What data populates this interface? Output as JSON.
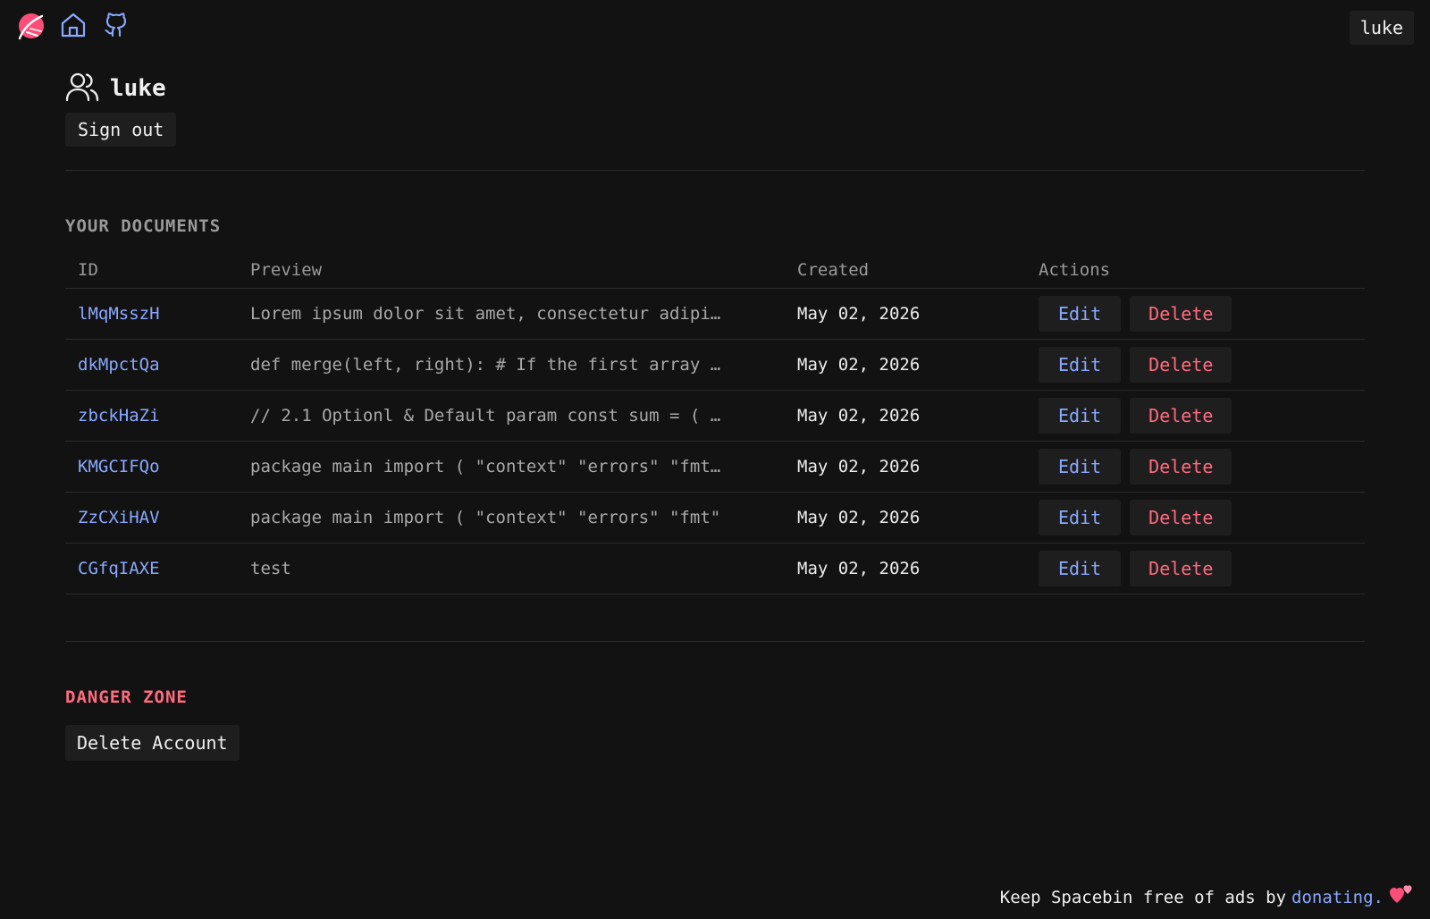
{
  "nav": {
    "logo_icon": "spacebin-logo-icon",
    "home_icon": "home-icon",
    "github_icon": "github-icon",
    "user_label": "luke"
  },
  "profile": {
    "icon": "users-icon",
    "username": "luke",
    "signout_label": "Sign out"
  },
  "documents": {
    "section_title": "YOUR DOCUMENTS",
    "columns": [
      "ID",
      "Preview",
      "Created",
      "Actions"
    ],
    "rows": [
      {
        "id": "lMqMsszH",
        "preview": "Lorem ipsum dolor sit amet, consectetur adipi…",
        "created": "May 02, 2026",
        "edit": "Edit",
        "delete": "Delete"
      },
      {
        "id": "dkMpctQa",
        "preview": "def merge(left, right): # If the first array …",
        "created": "May 02, 2026",
        "edit": "Edit",
        "delete": "Delete"
      },
      {
        "id": "zbckHaZi",
        "preview": "// 2.1 Optionl & Default param const sum = ( …",
        "created": "May 02, 2026",
        "edit": "Edit",
        "delete": "Delete"
      },
      {
        "id": "KMGCIFQo",
        "preview": "package main import ( \"context\" \"errors\" \"fmt…",
        "created": "May 02, 2026",
        "edit": "Edit",
        "delete": "Delete"
      },
      {
        "id": "ZzCXiHAV",
        "preview": "package main import ( \"context\" \"errors\" \"fmt\"",
        "created": "May 02, 2026",
        "edit": "Edit",
        "delete": "Delete"
      },
      {
        "id": "CGfqIAXE",
        "preview": "test",
        "created": "May 02, 2026",
        "edit": "Edit",
        "delete": "Delete"
      }
    ]
  },
  "danger": {
    "title": "DANGER ZONE",
    "delete_account_label": "Delete Account"
  },
  "footer": {
    "text": "Keep Spacebin free of ads by",
    "link_label": "donating.",
    "heart_icon": "hearts-icon"
  },
  "colors": {
    "background": "#121212",
    "accent_link": "#8aa8ff",
    "danger": "#ff6b7f",
    "button_bg": "#1e1e1e"
  }
}
